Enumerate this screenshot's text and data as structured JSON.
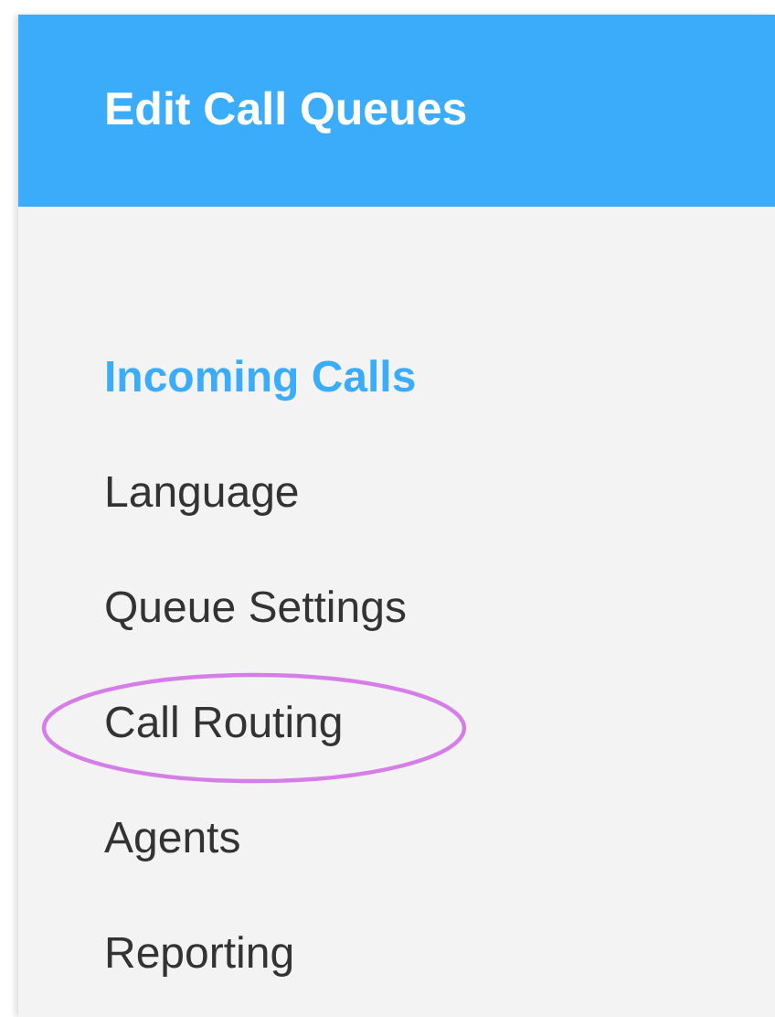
{
  "header": {
    "title": "Edit Call Queues"
  },
  "menu": [
    {
      "label": "Incoming Calls",
      "selected": true,
      "circled": false
    },
    {
      "label": "Language",
      "selected": false,
      "circled": false
    },
    {
      "label": "Queue Settings",
      "selected": false,
      "circled": false
    },
    {
      "label": "Call Routing",
      "selected": false,
      "circled": true
    },
    {
      "label": "Agents",
      "selected": false,
      "circled": false
    },
    {
      "label": "Reporting",
      "selected": false,
      "circled": false
    }
  ]
}
